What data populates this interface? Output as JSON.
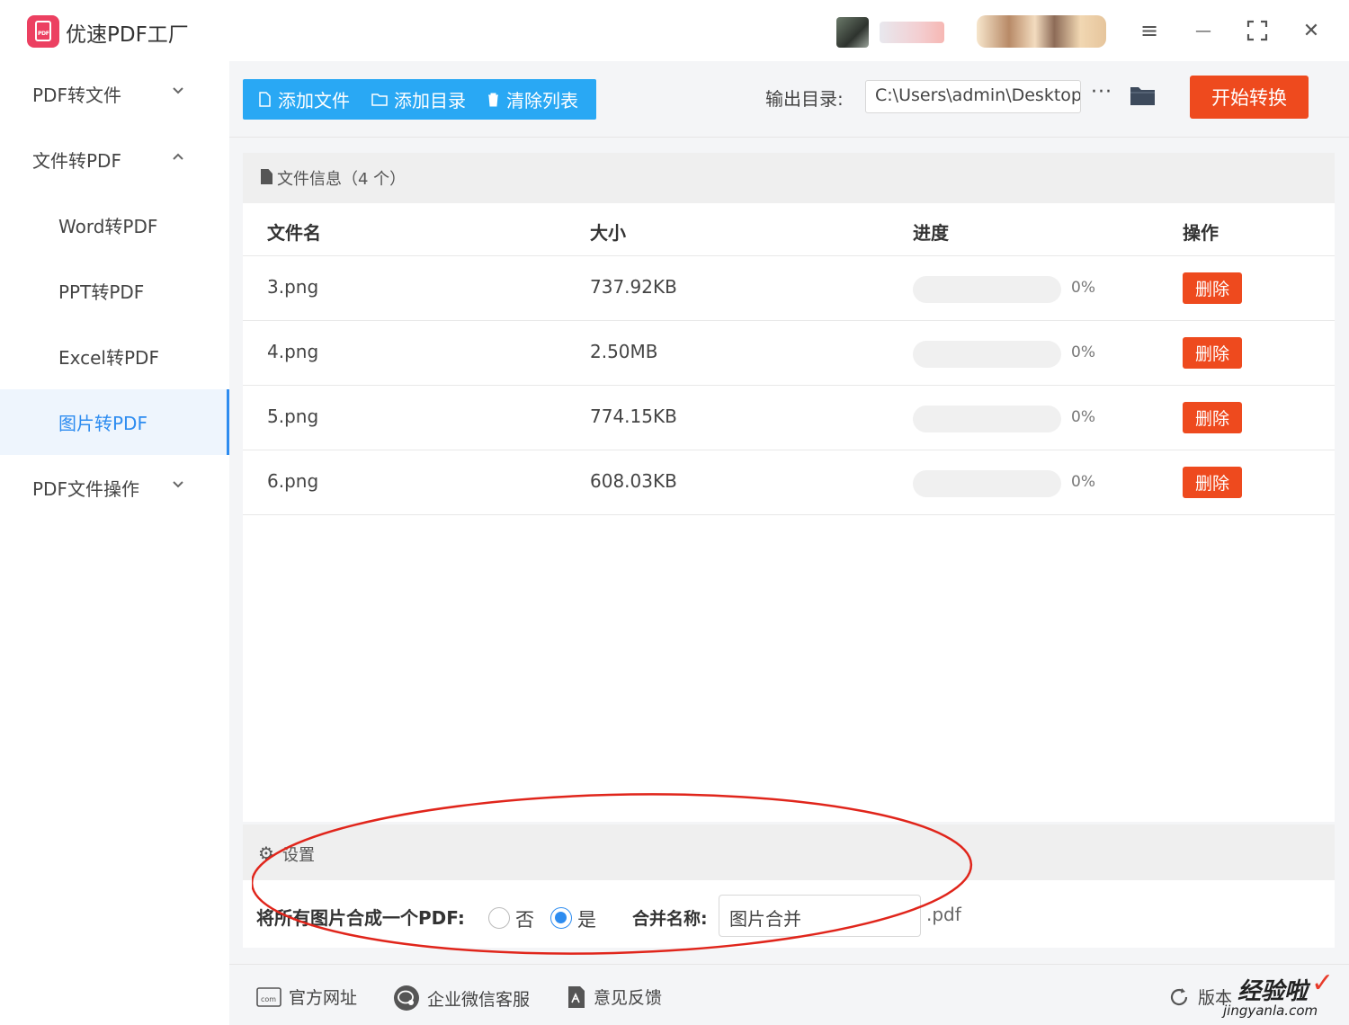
{
  "app": {
    "title": "优速PDF工厂",
    "logo_text": "PDF"
  },
  "window_controls": {
    "menu": "≡",
    "minimize": "—",
    "maximize": "⛶",
    "close": "✕"
  },
  "sidebar": {
    "items": [
      {
        "label": "PDF转文件",
        "type": "group",
        "chevron": "⌄"
      },
      {
        "label": "文件转PDF",
        "type": "group",
        "chevron": "⌃"
      },
      {
        "label": "Word转PDF",
        "type": "sub"
      },
      {
        "label": "PPT转PDF",
        "type": "sub"
      },
      {
        "label": "Excel转PDF",
        "type": "sub"
      },
      {
        "label": "图片转PDF",
        "type": "sub",
        "active": true
      },
      {
        "label": "PDF文件操作",
        "type": "group",
        "chevron": "⌄"
      }
    ]
  },
  "toolbar": {
    "add_file": "添加文件",
    "add_dir": "添加目录",
    "clear_list": "清除列表",
    "output_label": "输出目录:",
    "output_path": "C:\\Users\\admin\\Desktop",
    "more": "···",
    "start": "开始转换"
  },
  "file_panel": {
    "title": "文件信息（4 个）",
    "columns": {
      "name": "文件名",
      "size": "大小",
      "progress": "进度",
      "action": "操作"
    },
    "rows": [
      {
        "name": "3.png",
        "size": "737.92KB",
        "progress": 0,
        "progress_text": "0%",
        "action": "删除"
      },
      {
        "name": "4.png",
        "size": "2.50MB",
        "progress": 0,
        "progress_text": "0%",
        "action": "删除"
      },
      {
        "name": "5.png",
        "size": "774.15KB",
        "progress": 0,
        "progress_text": "0%",
        "action": "删除"
      },
      {
        "name": "6.png",
        "size": "608.03KB",
        "progress": 0,
        "progress_text": "0%",
        "action": "删除"
      }
    ]
  },
  "settings": {
    "title": "设置",
    "merge_label": "将所有图片合成一个PDF:",
    "option_no": "否",
    "option_yes": "是",
    "selected": "是",
    "name_label": "合并名称:",
    "name_value": "图片合并",
    "suffix": ".pdf"
  },
  "footer": {
    "website": "官方网址",
    "wechat": "企业微信客服",
    "feedback": "意见反馈",
    "version": "版本"
  },
  "watermark": {
    "main": "经验啦",
    "sub": "jingyanla.com",
    "check": "✓"
  },
  "colors": {
    "accent_blue": "#2d8cf0",
    "toolbar_blue": "#29a8f4",
    "danger_red": "#ee4a1e",
    "logo_pink": "#ec4061",
    "annotation_red": "#e0251b"
  }
}
